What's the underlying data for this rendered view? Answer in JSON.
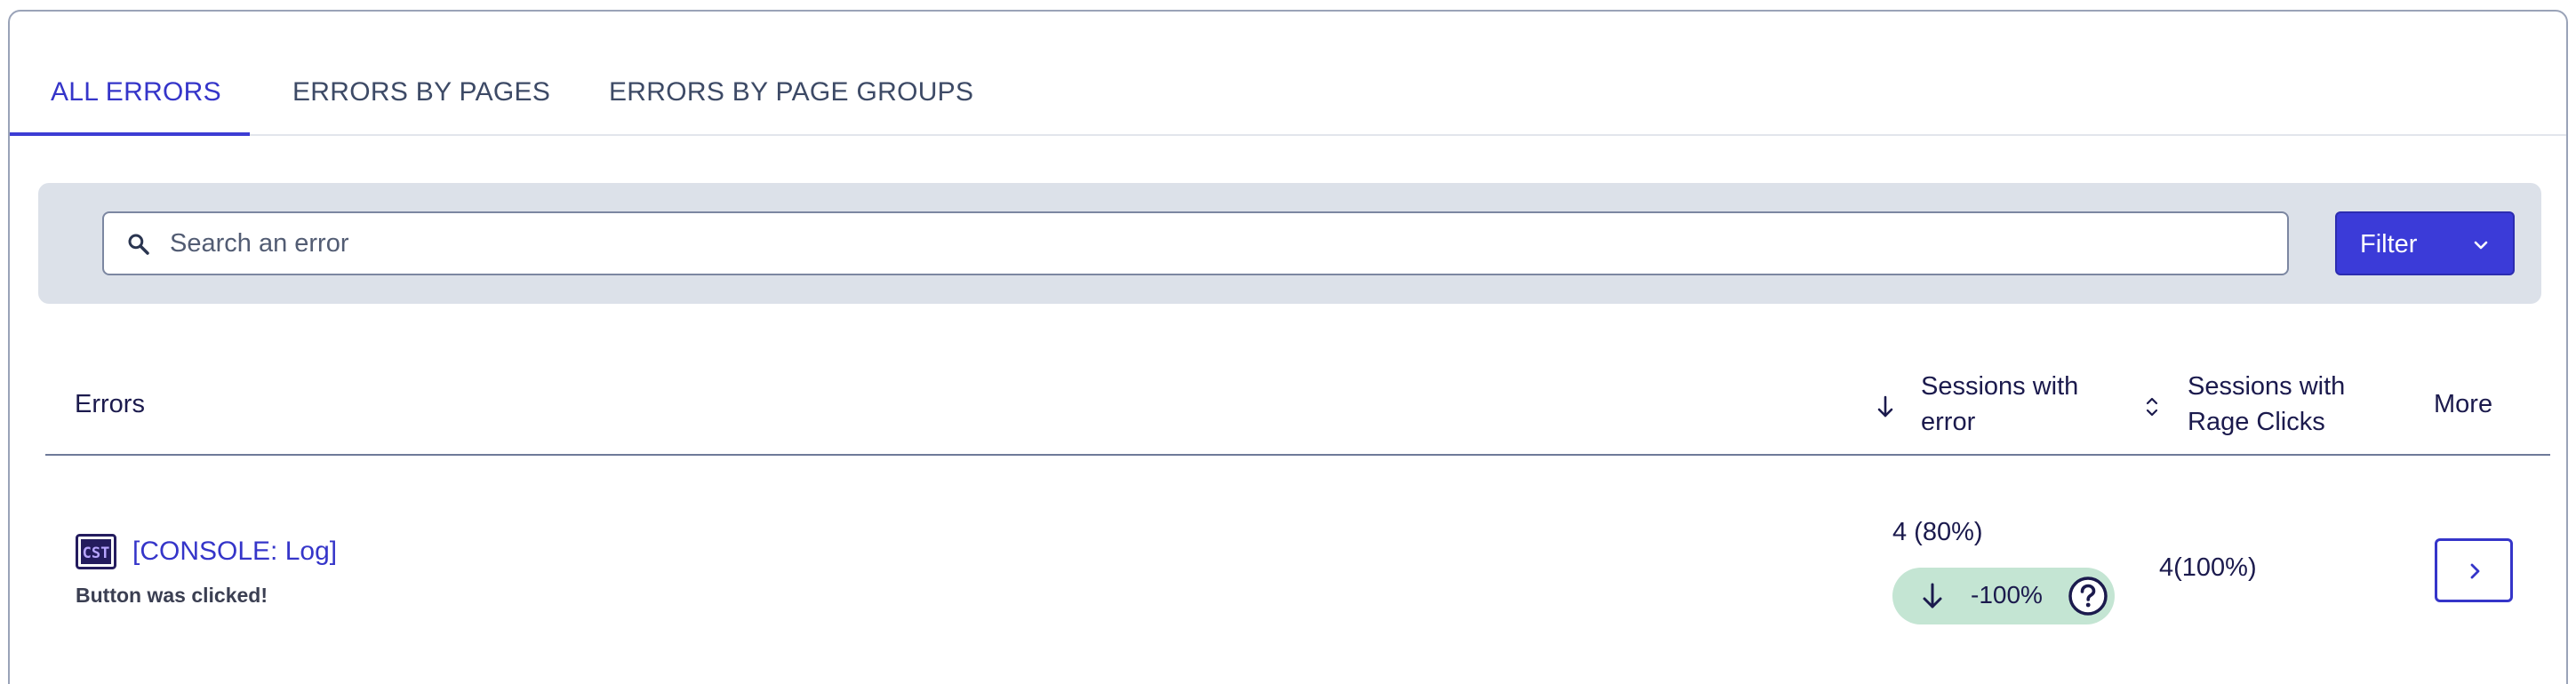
{
  "tabs": [
    {
      "label": "ALL ERRORS",
      "active": true
    },
    {
      "label": "ERRORS BY PAGES",
      "active": false
    },
    {
      "label": "ERRORS BY PAGE GROUPS",
      "active": false
    }
  ],
  "search": {
    "placeholder": "Search an error",
    "value": ""
  },
  "filter": {
    "label": "Filter"
  },
  "table": {
    "columns": {
      "errors": "Errors",
      "sessions_line1": "Sessions with",
      "sessions_line2": "error",
      "rage_line1": "Sessions with",
      "rage_line2": "Rage Clicks",
      "more": "More"
    },
    "rows": [
      {
        "icon": "cst-console-icon",
        "title": "[CONSOLE: Log]",
        "message": "Button was clicked!",
        "sessions_with_error": "4 (80%)",
        "trend": "-100%",
        "sessions_with_rage_clicks": "4(100%)"
      }
    ]
  },
  "colors": {
    "accent": "#3b3bd8",
    "search_band": "#dce1e9",
    "trend_pill": "#c4e5d3"
  }
}
